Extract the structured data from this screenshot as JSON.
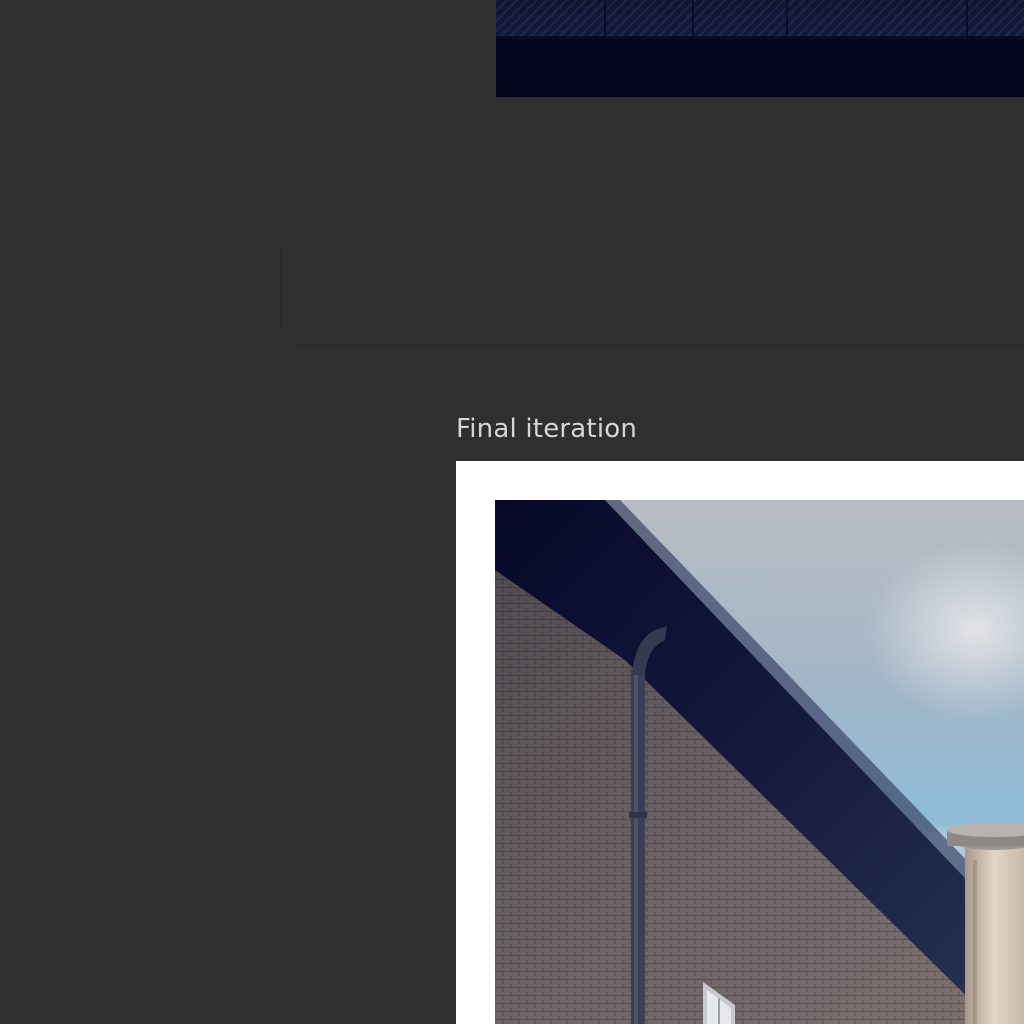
{
  "caption": "Final iteration"
}
